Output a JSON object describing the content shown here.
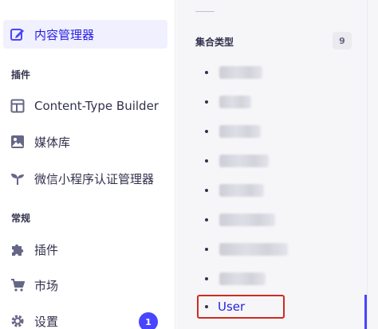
{
  "sidebar": {
    "content_manager": "内容管理器",
    "plugins_section": "插件",
    "plugin_items": [
      "Content-Type Builder",
      "媒体库",
      "微信小程序认证管理器"
    ],
    "general_section": "常规",
    "general_items": [
      "插件",
      "市场",
      "设置"
    ],
    "settings_badge": "1"
  },
  "panel": {
    "header": "集合类型",
    "count": "9",
    "selected_item": "User"
  },
  "colors": {
    "accent": "#4945ff",
    "highlight_border": "#d02b20"
  }
}
